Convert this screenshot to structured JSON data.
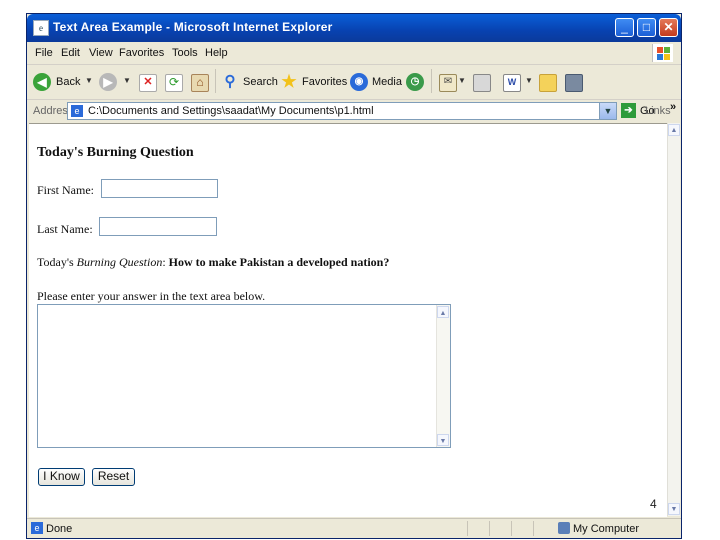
{
  "window": {
    "title": "Text Area Example - Microsoft Internet Explorer",
    "minimize_glyph": "_",
    "maximize_glyph": "□",
    "close_glyph": "✕"
  },
  "menu": {
    "items": [
      "File",
      "Edit",
      "View",
      "Favorites",
      "Tools",
      "Help"
    ]
  },
  "toolbar": {
    "back_label": "Back",
    "search_label": "Search",
    "favorites_label": "Favorites",
    "media_label": "Media"
  },
  "address": {
    "label": "Address",
    "url": "C:\\Documents and Settings\\saadat\\My Documents\\p1.html",
    "go_label": "Go",
    "links_label": "Links",
    "links_chevron": "»"
  },
  "page": {
    "heading": "Today's Burning Question",
    "first_name_label": "First Name:",
    "first_name_value": "",
    "last_name_label": "Last Name:",
    "last_name_value": "",
    "question_prefix": "Today's ",
    "question_italic": "Burning Question",
    "question_colon": ": ",
    "question_text": "How to make Pakistan a developed nation?",
    "instruction": "Please enter your answer in the text area below.",
    "answer_value": "",
    "submit_label": "I Know",
    "reset_label": "Reset"
  },
  "status": {
    "text": "Done",
    "zone": "My Computer"
  },
  "slide_number": "4",
  "icons": {
    "back": "back-arrow-icon",
    "forward": "forward-arrow-icon",
    "stop": "stop-icon",
    "refresh": "refresh-icon",
    "home": "home-icon",
    "search": "magnifier-icon",
    "favorites": "star-icon",
    "media": "media-globe-icon",
    "history": "history-icon",
    "mail": "mail-icon",
    "print": "printer-icon",
    "edit": "word-edit-icon",
    "discuss": "folder-icon",
    "messenger": "messenger-icon"
  },
  "colors": {
    "titlebar": "#0842b0",
    "chrome": "#ece9d8",
    "accent_button_border": "#003c74"
  }
}
